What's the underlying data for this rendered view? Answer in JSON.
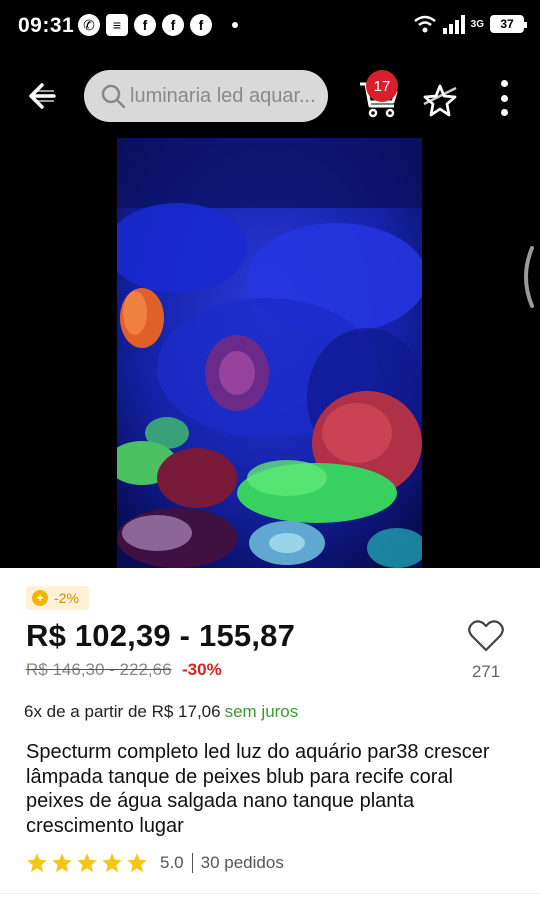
{
  "status_bar": {
    "time": "09:31",
    "network": "3G",
    "battery": "37",
    "icons": [
      "whatsapp-icon",
      "message-icon",
      "facebook-icon",
      "facebook-icon",
      "facebook-icon",
      "wifi-icon",
      "signal-icon",
      "battery-icon"
    ]
  },
  "header": {
    "search_text": "luminaria led aquar...",
    "cart_count": "17"
  },
  "product": {
    "discount_badge": "-2%",
    "price": "R$ 102,39 - 155,87",
    "old_price": "R$ 146,30 - 222,66",
    "discount_percent": "-30%",
    "wishlist_count": "271",
    "installments_text": "6x de a partir de R$ 17,06",
    "installments_note": "sem juros",
    "title": "Specturm completo led luz do aquário par38 crescer lâmpada tanque de peixes blub para recife coral peixes de água salgada nano tanque planta crescimento lugar",
    "rating_value": "5.0",
    "rating_stars": 5,
    "orders": "30 pedidos"
  },
  "colors": {
    "accent_red": "#e02020",
    "badge_red": "#d8202c",
    "star_yellow": "#f5c518",
    "green": "#3a9d2e"
  }
}
